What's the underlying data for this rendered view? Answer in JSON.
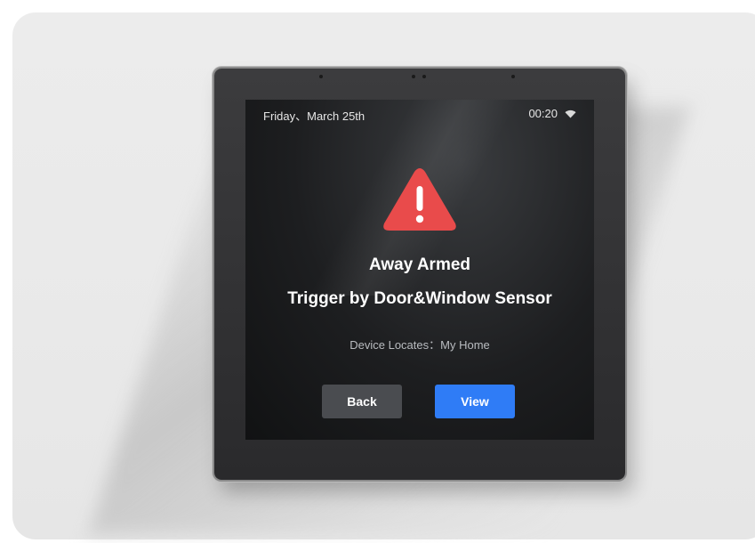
{
  "status_bar": {
    "date": "Friday、March 25th",
    "time": "00:20",
    "wifi_icon": "wifi-icon"
  },
  "alert": {
    "icon": "warning-triangle-icon",
    "icon_color": "#e94b4b",
    "title": "Away Armed",
    "subtitle": "Trigger by Door&Window Sensor",
    "location_text": "Device Locates：My Home"
  },
  "buttons": {
    "back_label": "Back",
    "view_label": "View"
  },
  "colors": {
    "accent": "#2f7cf6",
    "secondary_button": "#4a4c50",
    "screen_bg": "#1d1e20"
  }
}
